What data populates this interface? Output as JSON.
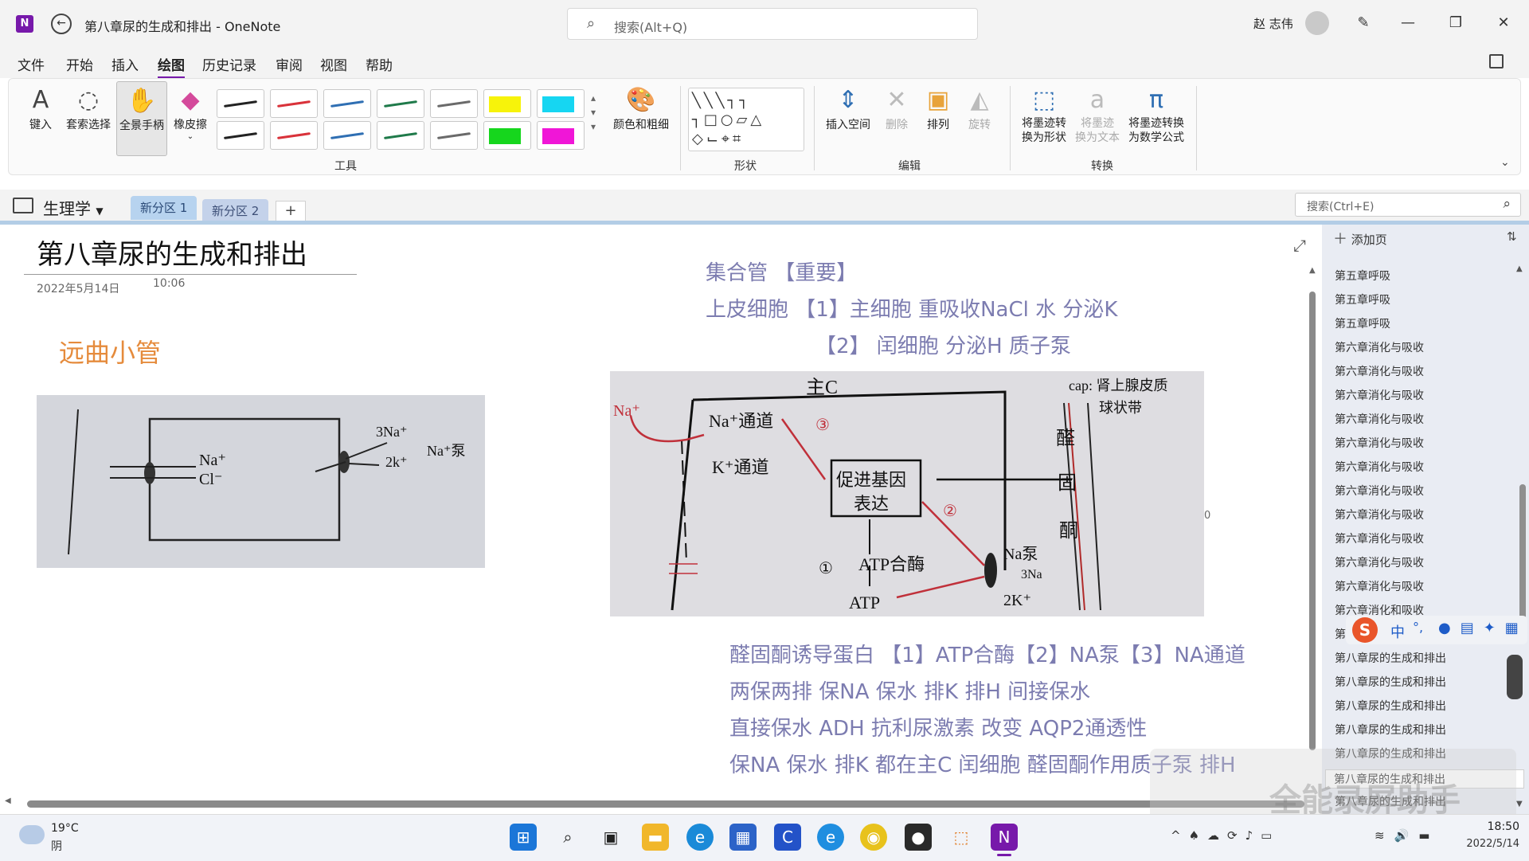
{
  "window": {
    "title": "第八章尿的生成和排出 - OneNote",
    "search_placeholder": "搜索(Alt+Q)",
    "user_name": "赵 志伟"
  },
  "menu": [
    "文件",
    "开始",
    "插入",
    "绘图",
    "历史记录",
    "审阅",
    "视图",
    "帮助"
  ],
  "menu_active": "绘图",
  "ribbon": {
    "type_label": "键入",
    "lasso_label": "套索选择",
    "pan_label": "全景手柄",
    "eraser_label": "橡皮擦",
    "color_thickness_label": "颜色和粗细",
    "tools_group": "工具",
    "shapes_group": "形状",
    "insert_space_label": "插入空间",
    "delete_label": "删除",
    "arrange_label": "排列",
    "rotate_label": "旋转",
    "edit_group": "编辑",
    "ink_to_shape_l1": "将墨迹转",
    "ink_to_shape_l2": "换为形状",
    "ink_to_text_l1": "将墨迹",
    "ink_to_text_l2": "换为文本",
    "ink_to_math_l1": "将墨迹转换",
    "ink_to_math_l2": "为数学公式",
    "convert_group": "转换",
    "pen_colors": [
      "#222222",
      "#d9323a",
      "#2f6fb3",
      "#1f7a4a",
      "#6a6a6a",
      "#222222",
      "#d9323a",
      "#2f6fb3",
      "#1f7a4a",
      "#6a6a6a"
    ],
    "highlighter_colors": [
      "#f7f30a",
      "#16d6f2",
      "#16d61d",
      "#f016d7"
    ]
  },
  "notebook": {
    "name": "生理学",
    "sections": [
      "新分区 1",
      "新分区 2"
    ],
    "add_section": "+",
    "page_search_placeholder": "搜索(Ctrl+E)"
  },
  "page": {
    "title": "第八章尿的生成和排出",
    "date": "2022年5月14日",
    "time": "10:06",
    "section_heading": "远曲小管",
    "lines_top": [
      "集合管  【重要】",
      "上皮细胞  【1】主细胞  重吸收NaCl 水 分泌K",
      "【2】  闰细胞  分泌H 质子泵"
    ],
    "lines_bottom": [
      "醛固酮诱导蛋白 【1】ATP合酶【2】NA泵【3】NA通道",
      "两保两排  保NA 保水  排K 排H 间接保水",
      "直接保水 ADH 抗利尿激素 改变 AQP2通透性",
      "保NA 保水  排K  都在主C     闰细胞 醛固酮作用质子泵 排H"
    ],
    "stray_mark": "0",
    "sketch_left": {
      "na": "Na⁺",
      "cl": "Cl⁻",
      "na3": "3Na⁺",
      "k2": "2k⁺",
      "pump": "Na⁺泵"
    },
    "sketch_right": {
      "na_out": "Na⁺",
      "main_c": "主C",
      "na_channel": "Na⁺通道",
      "k_channel": "K⁺通道",
      "promote_gene": "促进基因",
      "express": "表达",
      "atp_synthase": "ATP合酶",
      "atp": "ATP",
      "na_pump": "Na泵",
      "three_na": "3Na",
      "two_k": "2K⁺",
      "cap": "cap: 肾上腺皮质",
      "cap2": "球状带",
      "aldo1": "醛",
      "aldo2": "固",
      "aldo3": "酮",
      "n1": "①",
      "n2": "②",
      "n3": "③"
    }
  },
  "page_list": {
    "add_page": "添加页",
    "items": [
      "第五章呼吸",
      "第五章呼吸",
      "第五章呼吸",
      "第六章消化与吸收",
      "第六章消化与吸收",
      "第六章消化与吸收",
      "第六章消化与吸收",
      "第六章消化与吸收",
      "第六章消化与吸收",
      "第六章消化与吸收",
      "第六章消化与吸收",
      "第六章消化与吸收",
      "第六章消化与吸收",
      "第六章消化与吸收",
      "第六章消化和吸收",
      "第六",
      "第八章尿的生成和排出",
      "第八章尿的生成和排出",
      "第八章尿的生成和排出",
      "第八章尿的生成和排出",
      "第八章尿的生成和排出",
      "第八章尿的生成和排出",
      "第八章尿的生成和排出"
    ],
    "selected_index": 21
  },
  "ime": {
    "logo": "S",
    "mode": "中",
    "punct": "°,"
  },
  "taskbar": {
    "temperature": "19°C",
    "condition": "阴",
    "time": "18:50",
    "date": "2022/5/14",
    "watermark": "全能录屏助手"
  }
}
